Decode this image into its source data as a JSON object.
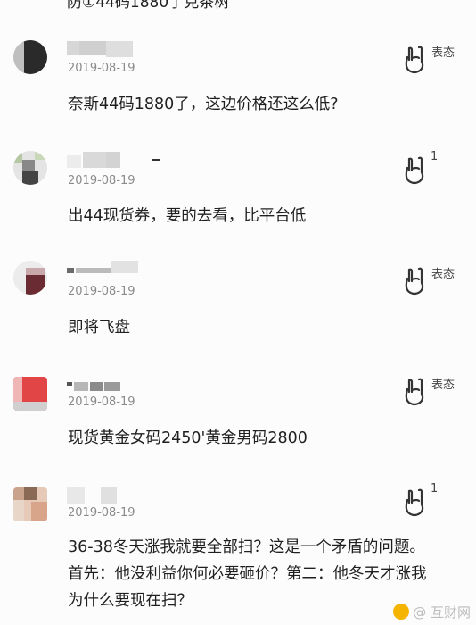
{
  "top_partial_text": "防①44码1880了克茶树",
  "comments": [
    {
      "date": "2019-08-19",
      "text": "奈斯44码1880了，这边价格还这么低?",
      "reaction": {
        "label": "表态",
        "count": ""
      }
    },
    {
      "date": "2019-08-19",
      "text": "出44现货券，要的去看，比平台低",
      "reaction": {
        "label": "",
        "count": "1"
      }
    },
    {
      "date": "2019-08-19",
      "text": "即将飞盘",
      "reaction": {
        "label": "表态",
        "count": ""
      }
    },
    {
      "date": "2019-08-19",
      "text": "现货黄金女码2450'黄金男码2800",
      "reaction": {
        "label": "表态",
        "count": ""
      }
    },
    {
      "date": "2019-08-19",
      "text": "36-38冬天涨我就要全部扫？这是一个矛盾的问题。首先：他没利益你何必要砸价？第二：他冬天才涨我为什么要现在扫？",
      "reaction": {
        "label": "",
        "count": "1"
      }
    }
  ],
  "watermark": "@ 互财网",
  "icons": {
    "reaction": "rock-hand-icon",
    "avatar": "pixelated-avatar"
  }
}
